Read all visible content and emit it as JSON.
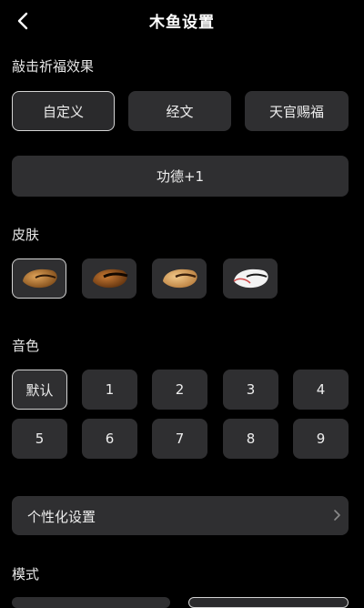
{
  "header": {
    "title": "木鱼设置"
  },
  "effect": {
    "section_label": "敲击祈福效果",
    "options": [
      "自定义",
      "经文",
      "天官赐福"
    ],
    "selected": "自定义",
    "merit_button": "功德+1"
  },
  "skin": {
    "section_label": "皮肤",
    "items": [
      "wooden-fish-brown-icon",
      "wooden-fish-dark-icon",
      "wooden-fish-light-icon",
      "wooden-fish-white-icon"
    ],
    "selected_index": 0
  },
  "tone": {
    "section_label": "音色",
    "options": [
      "默认",
      "1",
      "2",
      "3",
      "4",
      "5",
      "6",
      "7",
      "8",
      "9"
    ],
    "selected": "默认"
  },
  "personalize": {
    "label": "个性化设置",
    "icon": "chevron-right-icon"
  },
  "mode": {
    "section_label": "模式"
  },
  "colors": {
    "background": "#000000",
    "card": "#2f2f31",
    "selected_border": "#d4d4d4",
    "text": "#ececec"
  }
}
